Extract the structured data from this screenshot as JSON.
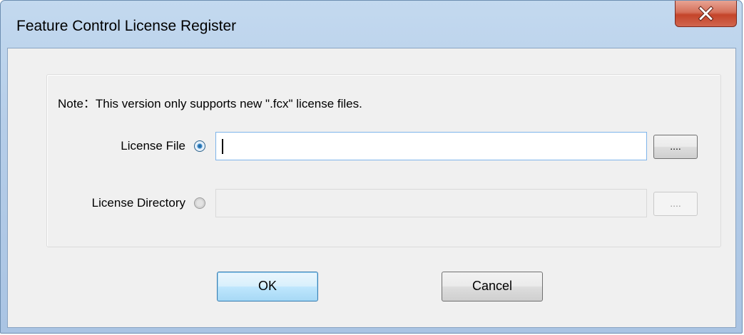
{
  "window": {
    "title": "Feature Control License Register",
    "close_icon": "close-x-icon"
  },
  "note": {
    "label": "Note",
    "separator": "：",
    "text": "This version only supports new \".fcx\" license files."
  },
  "license_file": {
    "label": "License File",
    "selected": true,
    "value": "",
    "browse_label": "....",
    "enabled": true
  },
  "license_directory": {
    "label": "License Directory",
    "selected": false,
    "value": "",
    "browse_label": "....",
    "enabled": false
  },
  "buttons": {
    "ok_label": "OK",
    "cancel_label": "Cancel"
  },
  "colors": {
    "titlebar": "#b5cde8",
    "close_button": "#c4442a",
    "default_button": "#bee6fd",
    "client_background": "#f0f0f0"
  }
}
